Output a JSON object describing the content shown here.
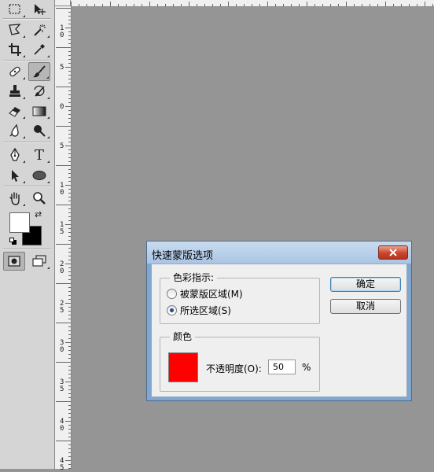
{
  "toolbar": {
    "tools": [
      {
        "name": "rectangular-marquee-tool"
      },
      {
        "name": "move-tool"
      },
      {
        "name": "lasso-tool"
      },
      {
        "name": "quick-selection-tool"
      },
      {
        "name": "crop-tool"
      },
      {
        "name": "eyedropper-tool"
      },
      {
        "name": "spot-healing-brush-tool"
      },
      {
        "name": "brush-tool"
      },
      {
        "name": "clone-stamp-tool"
      },
      {
        "name": "history-brush-tool"
      },
      {
        "name": "eraser-tool"
      },
      {
        "name": "gradient-tool"
      },
      {
        "name": "blur-tool"
      },
      {
        "name": "dodge-tool"
      },
      {
        "name": "pen-tool"
      },
      {
        "name": "type-tool"
      },
      {
        "name": "path-selection-tool"
      },
      {
        "name": "ellipse-tool"
      },
      {
        "name": "hand-tool"
      },
      {
        "name": "zoom-tool"
      }
    ],
    "type_tool_glyph": "T",
    "foreground_color": "#ffffff",
    "background_color": "#000000"
  },
  "ruler": {
    "vertical_labels": [
      "1\n0",
      "5",
      "0",
      "5",
      "1\n0",
      "1\n5",
      "2\n0",
      "2\n5",
      "3\n0",
      "3\n5",
      "4\n0",
      "4\n5"
    ]
  },
  "dialog": {
    "title": "快速蒙版选项",
    "color_indicates": {
      "legend": "色彩指示:",
      "options": [
        {
          "label": "被蒙版区域(M)",
          "checked": false
        },
        {
          "label": "所选区域(S)",
          "checked": true
        }
      ]
    },
    "color_group": {
      "legend": "颜色",
      "swatch_color": "#ff0000",
      "opacity_label": "不透明度(O):",
      "opacity_value": "50",
      "percent": "%"
    },
    "ok_label": "确定",
    "cancel_label": "取消"
  }
}
